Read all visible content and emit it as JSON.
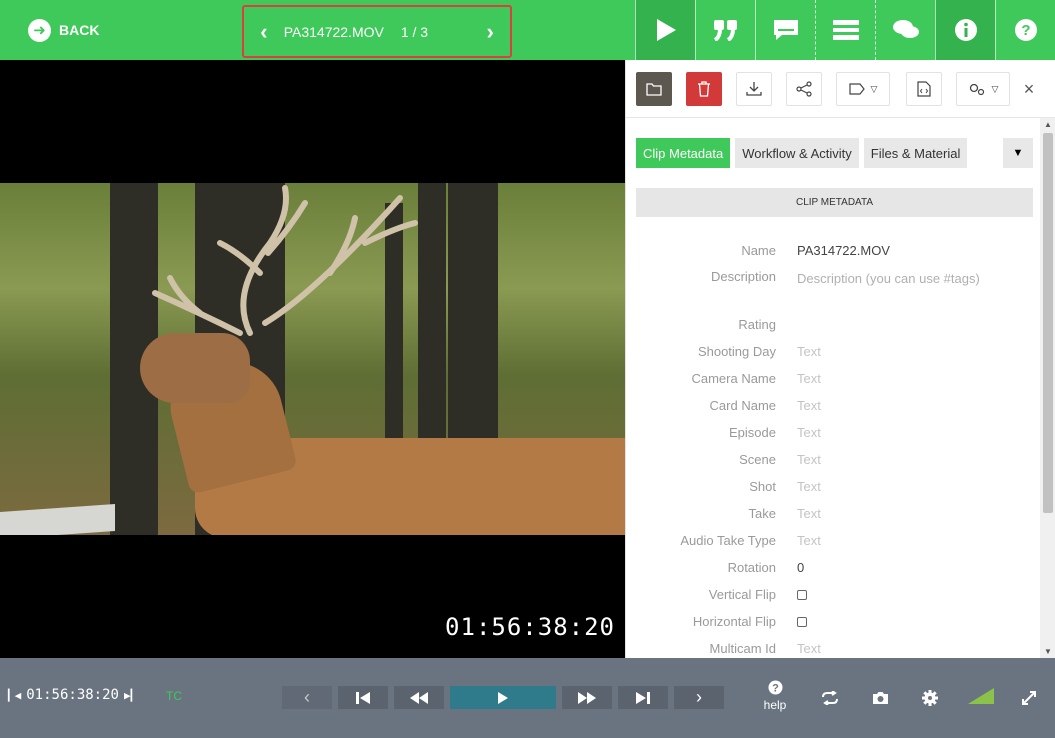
{
  "topbar": {
    "back_label": "BACK",
    "clip_name": "PA314722.MOV",
    "clip_position": "1 / 3",
    "icons": [
      "play-icon",
      "quote-icon",
      "subtitles-icon",
      "list-icon",
      "chat-icon",
      "info-icon",
      "help-icon"
    ]
  },
  "video": {
    "timecode": "01:56:38:20"
  },
  "panel": {
    "tabs": [
      "Clip Metadata",
      "Workflow & Activity",
      "Files & Material"
    ],
    "section_title": "CLIP METADATA",
    "fields": [
      {
        "label": "Name",
        "value": "PA314722.MOV"
      },
      {
        "label": "Description",
        "value": "Description (you can use #tags)"
      },
      {
        "label": "Rating",
        "value": ""
      },
      {
        "label": "Shooting Day",
        "value": "Text"
      },
      {
        "label": "Camera Name",
        "value": "Text"
      },
      {
        "label": "Card Name",
        "value": "Text"
      },
      {
        "label": "Episode",
        "value": "Text"
      },
      {
        "label": "Scene",
        "value": "Text"
      },
      {
        "label": "Shot",
        "value": "Text"
      },
      {
        "label": "Take",
        "value": "Text"
      },
      {
        "label": "Audio Take Type",
        "value": "Text"
      },
      {
        "label": "Rotation",
        "value": "0"
      },
      {
        "label": "Vertical Flip",
        "value": ""
      },
      {
        "label": "Horizontal Flip",
        "value": ""
      },
      {
        "label": "Multicam Id",
        "value": "Text"
      }
    ]
  },
  "bottombar": {
    "timecode": "01:56:38:20",
    "tc_label": "TC",
    "help_label": "help"
  },
  "colors": {
    "accent": "#3fc95a",
    "delete": "#d23a3a",
    "play": "#2f7b8c",
    "bottombar": "#6a7480"
  }
}
